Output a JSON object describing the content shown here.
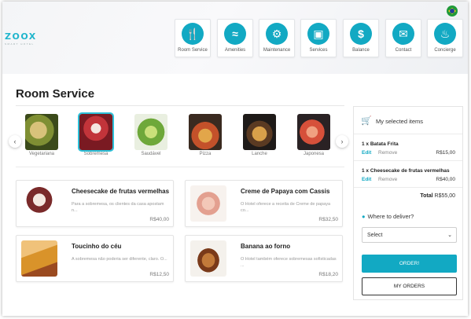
{
  "brand": {
    "name": "ZOOX",
    "tagline": "SMART HOTEL"
  },
  "nav": [
    {
      "label": "Room Service",
      "icon": "utensils-icon",
      "glyph": "🍴"
    },
    {
      "label": "Amenities",
      "icon": "pool-icon",
      "glyph": "≈"
    },
    {
      "label": "Maintenance",
      "icon": "gears-icon",
      "glyph": "⚙"
    },
    {
      "label": "Services",
      "icon": "luggage-cart-icon",
      "glyph": "▣"
    },
    {
      "label": "Balance",
      "icon": "dollar-icon",
      "glyph": "$"
    },
    {
      "label": "Contact",
      "icon": "envelope-icon",
      "glyph": "✉"
    },
    {
      "label": "Concierge",
      "icon": "bell-icon",
      "glyph": "♨"
    }
  ],
  "page_title": "Room Service",
  "categories": [
    {
      "name": "Vegetariana",
      "color": "#8a9a3a"
    },
    {
      "name": "Sobremesa",
      "color": "#b33a3e",
      "selected": true
    },
    {
      "name": "Saudável",
      "color": "#6ea83a"
    },
    {
      "name": "Pizza",
      "color": "#c86a2a"
    },
    {
      "name": "Lanche",
      "color": "#6a4a2a"
    },
    {
      "name": "Japonesa",
      "color": "#d6684a"
    }
  ],
  "products": [
    {
      "name": "Cheesecake de frutas vermelhas",
      "description": "Para a sobremesa, os clientes da casa apostam n...",
      "price": "R$40,00",
      "color": "#7a2a2a"
    },
    {
      "name": "Creme de Papaya com Cassis",
      "description": "O Hotel oferece a receita de Creme de papaya co...",
      "price": "R$32,50",
      "color": "#e3a090"
    },
    {
      "name": "Toucinho do céu",
      "description": "A sobremesa não poderia ser diferente, claro. O...",
      "price": "R$12,50",
      "color": "#d9932a"
    },
    {
      "name": "Banana ao forno",
      "description": "O Hotel também oferece sobremesas sofisticadas ...",
      "price": "R$18,20",
      "color": "#9a5a2a"
    }
  ],
  "order": {
    "title": "My selected items",
    "items": [
      {
        "name": "1 x Batata Frita",
        "price": "R$15,00"
      },
      {
        "name": "1 x Cheesecake de frutas vermelhas",
        "price": "R$40,00"
      }
    ],
    "edit_label": "Edit",
    "remove_label": "Remove",
    "total_label": "Total",
    "total_value": "R$55,00",
    "deliver_question": "Where to deliver?",
    "select_value": "Select",
    "order_button": "ORDER!",
    "my_orders_button": "MY ORDERS"
  },
  "colors": {
    "accent": "#12a9c3"
  }
}
